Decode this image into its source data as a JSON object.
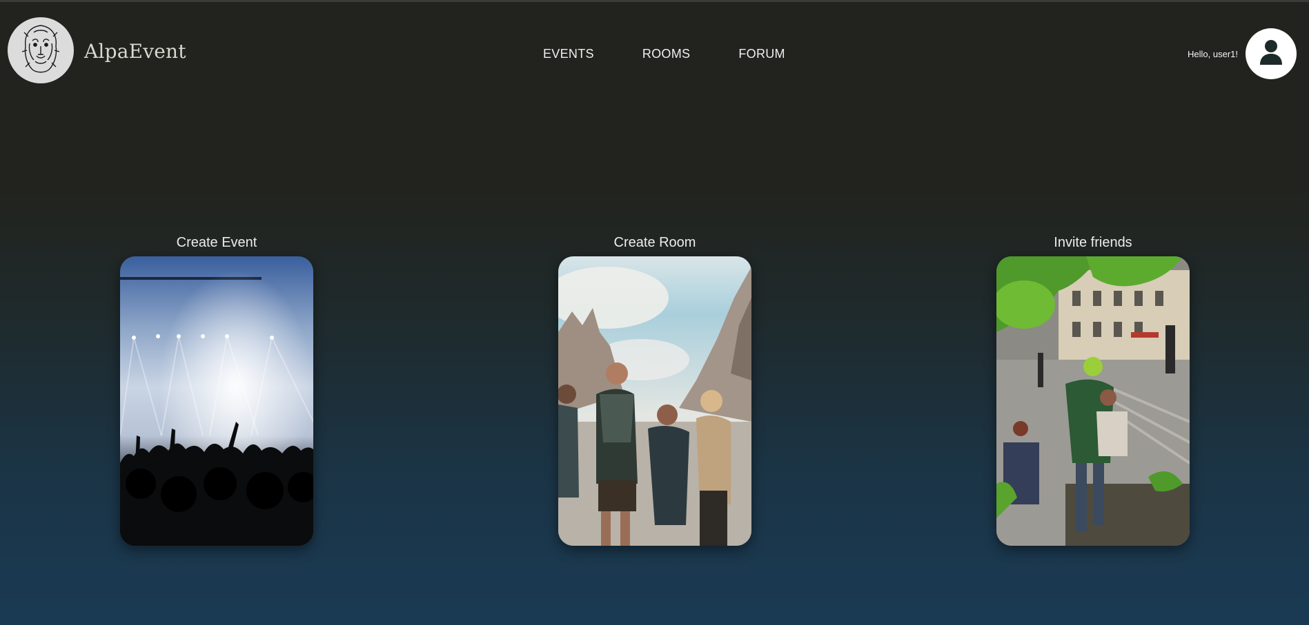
{
  "app": {
    "brand_name": "AlpaEvent",
    "logo_icon": "lion-head-icon"
  },
  "nav": {
    "items": [
      {
        "label": "EVENTS"
      },
      {
        "label": "ROOMS"
      },
      {
        "label": "FORUM"
      }
    ]
  },
  "user": {
    "greeting": "Hello, user1!",
    "avatar_icon": "user-icon"
  },
  "cards": [
    {
      "title": "Create Event",
      "image": "concert-crowd-image"
    },
    {
      "title": "Create Room",
      "image": "friends-hiking-image"
    },
    {
      "title": "Invite friends",
      "image": "city-plaza-image"
    }
  ],
  "colors": {
    "background_top": "#22231e",
    "background_bottom": "#1a3a54",
    "text": "#ececec",
    "logo_bg": "#dcdcdc",
    "avatar_bg": "#ffffff"
  }
}
